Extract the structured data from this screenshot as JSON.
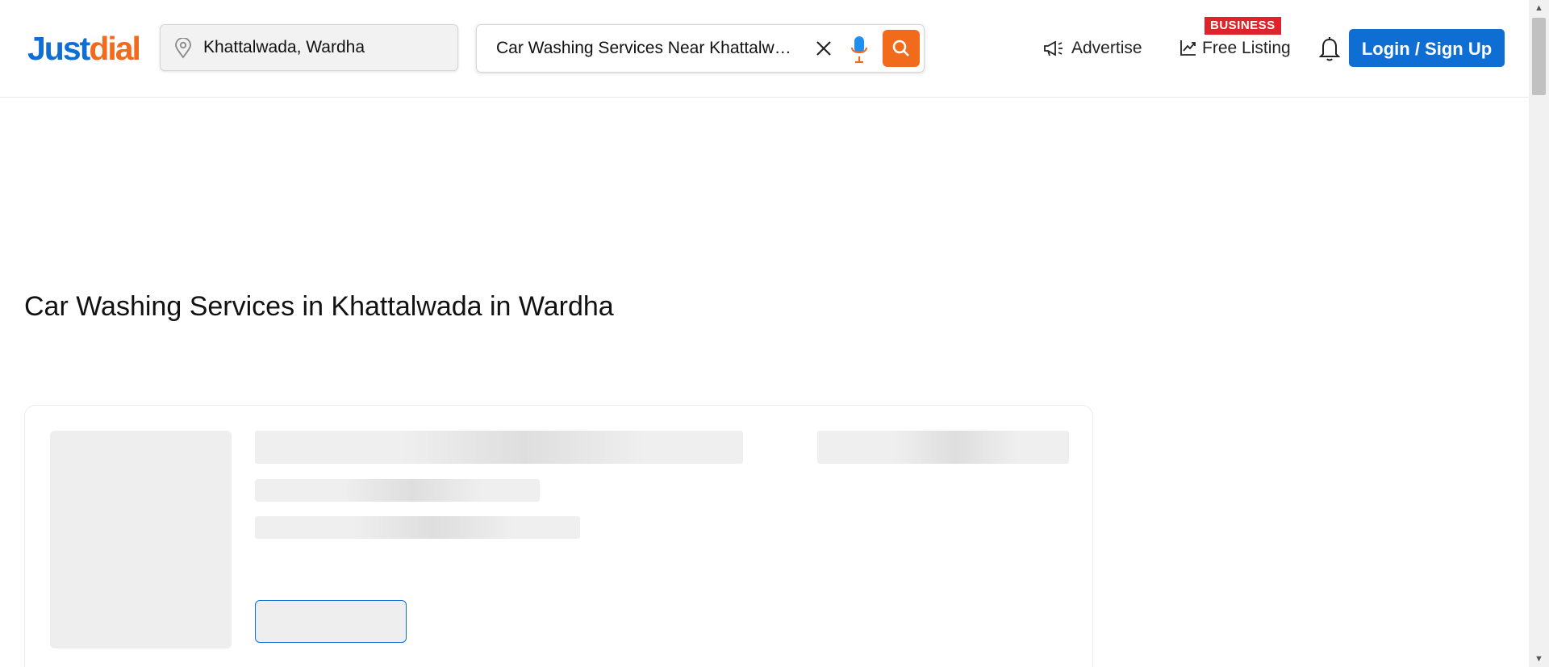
{
  "header": {
    "logo": {
      "part1": "Just",
      "part2": "dial",
      "colors": {
        "part1": "#0f6ed3",
        "part2": "#f26b1d"
      }
    },
    "location": {
      "value": "Khattalwada, Wardha",
      "icon": "map-pin-icon"
    },
    "search": {
      "value": "Car Washing Services Near Khattalwada",
      "clear_icon": "close-icon",
      "mic_icon": "microphone-icon",
      "submit_icon": "search-icon"
    },
    "nav": {
      "advertise": {
        "label": "Advertise",
        "icon": "megaphone-icon"
      },
      "free_listing": {
        "label": "Free Listing",
        "icon": "trending-up-icon",
        "badge": "BUSINESS"
      },
      "notifications_icon": "bell-icon",
      "login_label": "Login / Sign Up"
    }
  },
  "main": {
    "title": "Car Washing Services in Khattalwada in Wardha",
    "results_state": "loading"
  },
  "colors": {
    "brand_blue": "#0f6ed3",
    "brand_orange": "#f26b1d",
    "badge_red": "#e0232a",
    "skeleton": "#eeeeee"
  }
}
